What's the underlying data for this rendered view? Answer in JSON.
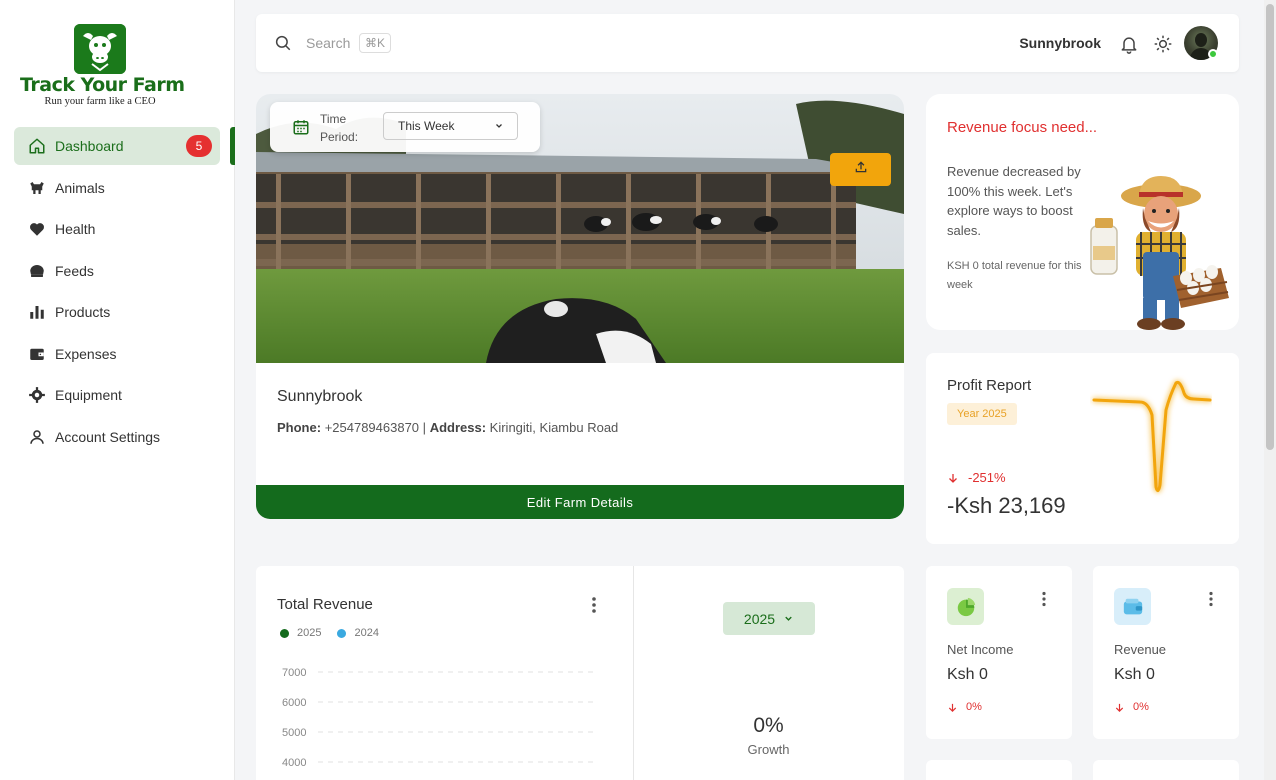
{
  "brand": {
    "title": "Track Your Farm",
    "tagline": "Run your farm like a CEO"
  },
  "sidebar": {
    "items": [
      {
        "label": "Dashboard",
        "icon": "home-icon",
        "badge": "5",
        "active": true
      },
      {
        "label": "Animals",
        "icon": "cow-icon"
      },
      {
        "label": "Health",
        "icon": "heart-icon"
      },
      {
        "label": "Feeds",
        "icon": "bowl-icon"
      },
      {
        "label": "Products",
        "icon": "bar-chart-icon"
      },
      {
        "label": "Expenses",
        "icon": "wallet-icon"
      },
      {
        "label": "Equipment",
        "icon": "gear-icon"
      },
      {
        "label": "Account Settings",
        "icon": "user-icon"
      }
    ]
  },
  "topbar": {
    "search_placeholder": "Search",
    "shortcut": "⌘K",
    "username": "Sunnybrook"
  },
  "farm": {
    "time_label": "Time Period:",
    "time_value": "This Week",
    "name": "Sunnybrook",
    "phone_label": "Phone:",
    "phone": "+254789463870",
    "separator": "|",
    "address_label": "Address:",
    "address": "Kiringiti, Kiambu Road",
    "edit_label": "Edit Farm Details"
  },
  "focus": {
    "title": "Revenue focus need...",
    "text": "Revenue decreased by 100% this week. Let's explore ways to boost sales.",
    "small": "KSH 0 total revenue for this week"
  },
  "profit": {
    "title": "Profit Report",
    "year": "Year 2025",
    "pct": "-251%",
    "value": "-Ksh 23,169"
  },
  "revenue": {
    "title": "Total Revenue",
    "legend": [
      {
        "label": "2025",
        "color": "#146b1d"
      },
      {
        "label": "2024",
        "color": "#3aa9e0"
      }
    ],
    "year_button": "2025",
    "growth_value": "0%",
    "growth_label": "Growth"
  },
  "chart_data": {
    "type": "line",
    "title": "Total Revenue",
    "series": [
      {
        "name": "2025",
        "values": []
      },
      {
        "name": "2024",
        "values": []
      }
    ],
    "y_ticks": [
      "7000",
      "6000",
      "5000",
      "4000"
    ],
    "ylim": [
      4000,
      7000
    ]
  },
  "stats": {
    "net_income": {
      "label": "Net Income",
      "value": "Ksh 0",
      "pct": "0%",
      "color": "#dcefd2"
    },
    "revenue": {
      "label": "Revenue",
      "value": "Ksh 0",
      "pct": "0%",
      "color": "#d8eefa"
    }
  },
  "colors": {
    "primary": "#146b1d",
    "accent": "#f2a50c",
    "danger": "#e03030"
  }
}
